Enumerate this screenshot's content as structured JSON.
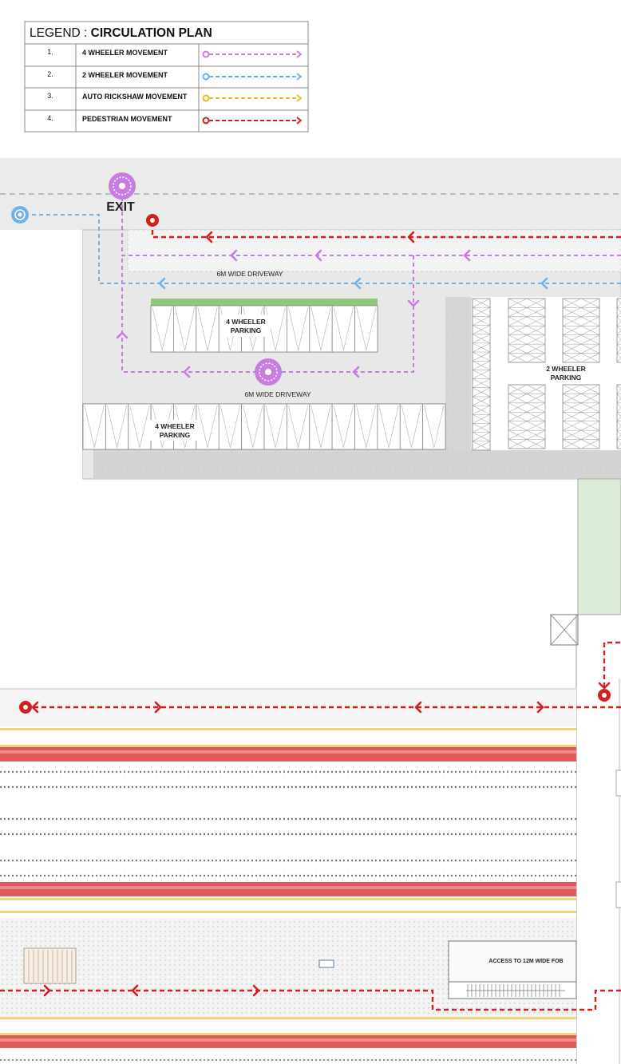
{
  "legend": {
    "title_prefix": "LEGEND : ",
    "title_bold": "CIRCULATION PLAN",
    "rows": [
      {
        "num": "1.",
        "label": "4 WHEELER MOVEMENT",
        "color": "#c77ce0",
        "icon": "origin-circle-dashed-arrow"
      },
      {
        "num": "2.",
        "label": "2 WHEELER MOVEMENT",
        "color": "#6fb2ea",
        "icon": "origin-circle-dashed-arrow"
      },
      {
        "num": "3.",
        "label": "AUTO RICKSHAW MOVEMENT",
        "color": "#e2c21a",
        "icon": "origin-circle-dashed-arrow"
      },
      {
        "num": "4.",
        "label": "PEDESTRIAN MOVEMENT",
        "color": "#d21f1f",
        "icon": "origin-circle-dashed-arrow"
      }
    ]
  },
  "labels": {
    "exit": "EXIT",
    "driveway_upper": "6M WIDE DRIVEWAY",
    "driveway_lower": "6M WIDE DRIVEWAY",
    "parking_4w_upper_1": "4 WHEELER",
    "parking_4w_upper_2": "PARKING",
    "parking_4w_lower_1": "4 WHEELER",
    "parking_4w_lower_2": "PARKING",
    "parking_2w_1": "2 WHEELER",
    "parking_2w_2": "PARKING",
    "fob_access": "ACCESS TO 12M WIDE FOB"
  },
  "colors": {
    "four_wheeler": "#c77ce0",
    "two_wheeler": "#6fb2ea",
    "auto_rickshaw": "#e2c21a",
    "pedestrian": "#d21f1f",
    "plaza_grey": "#e8e8e8",
    "road_red": "#e05a5a",
    "road_yellow": "#f3d47a",
    "green_strip": "#8fc87a",
    "green_area": "#dcebd6"
  }
}
